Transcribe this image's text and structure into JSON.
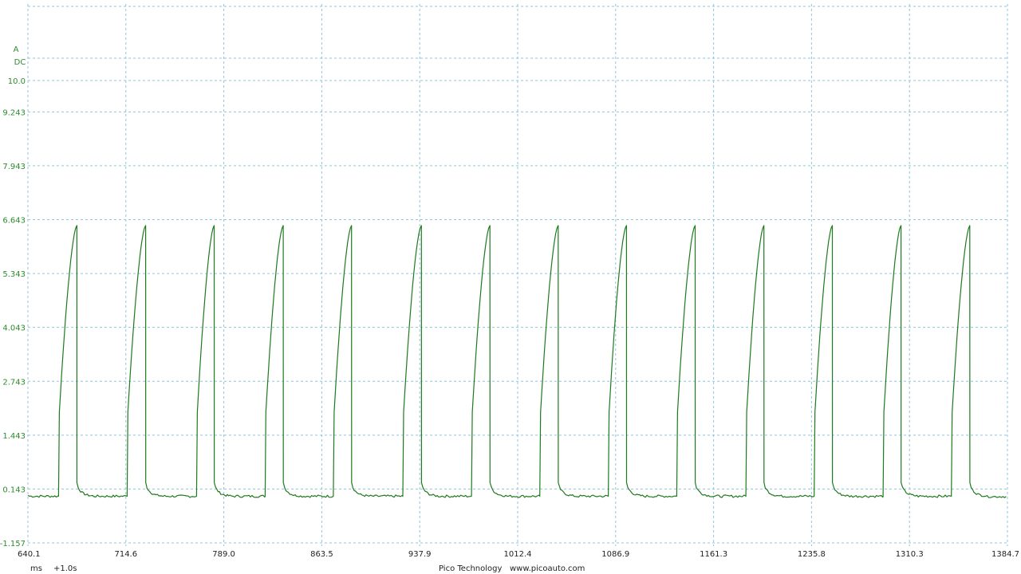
{
  "chart_data": {
    "type": "line",
    "title": "",
    "y_unit": "A",
    "coupling": "DC",
    "xlabel_unit": "ms",
    "x_offset_label": "+1.0s",
    "footer_left": "Pico Technology",
    "footer_right": "www.picoauto.com",
    "xlim": [
      640.1,
      1384.7
    ],
    "ylim": [
      -1.157,
      10.0
    ],
    "x_ticks": [
      "640.1",
      "714.6",
      "789.0",
      "863.5",
      "937.9",
      "1012.4",
      "1086.9",
      "1161.3",
      "1235.8",
      "1310.3",
      "1384.7"
    ],
    "y_ticks": [
      "10.0",
      "9.243",
      "7.943",
      "6.643",
      "5.343",
      "4.043",
      "2.743",
      "1.443",
      "0.143",
      "-1.157"
    ],
    "y_tick_values": [
      10.0,
      9.243,
      7.943,
      6.643,
      5.343,
      4.043,
      2.743,
      1.443,
      0.143,
      -1.157
    ],
    "grid": true,
    "color": "#1e7a1e",
    "series": [
      {
        "baseline": -0.03,
        "peak": 6.5,
        "post_drop": 0.25,
        "pulse_starts_ms": [
          663.4,
          715.5,
          768.3,
          820.4,
          872.3,
          925.1,
          977.3,
          1029.2,
          1081.3,
          1133.3,
          1185.9,
          1237.8,
          1290.2,
          1342.1
        ],
        "pulse_widths_ms": [
          13.9,
          14.1,
          13.4,
          13.8,
          13.8,
          14.1,
          14.0,
          14.0,
          13.8,
          14.0,
          13.7,
          13.8,
          13.6,
          14.0
        ]
      }
    ]
  }
}
